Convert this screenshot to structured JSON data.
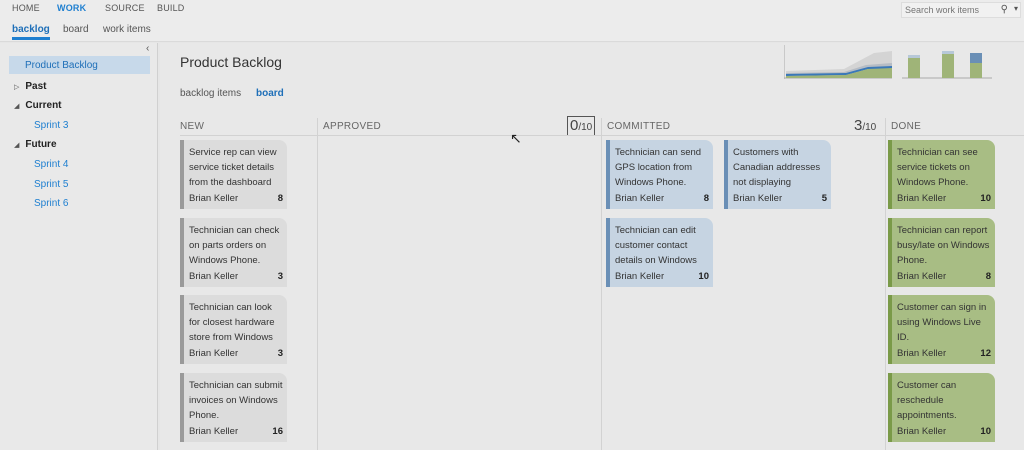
{
  "topnav": {
    "items": [
      "HOME",
      "WORK",
      "SOURCE",
      "BUILD"
    ],
    "active": "WORK",
    "search_placeholder": "Search work items"
  },
  "subnav": {
    "items": [
      "backlog",
      "board",
      "work items"
    ],
    "active": "backlog"
  },
  "sidebar": {
    "selected": "Product Backlog",
    "groups": [
      {
        "label": "Past",
        "expanded": false,
        "items": []
      },
      {
        "label": "Current",
        "expanded": true,
        "items": [
          "Sprint 3"
        ]
      },
      {
        "label": "Future",
        "expanded": true,
        "items": [
          "Sprint 4",
          "Sprint 5",
          "Sprint 6"
        ]
      }
    ]
  },
  "main": {
    "title": "Product Backlog",
    "tabs": [
      "backlog items",
      "board"
    ],
    "active_tab": "board"
  },
  "columns": [
    {
      "name": "NEW"
    },
    {
      "name": "APPROVED",
      "wip_current": "0",
      "wip_limit": "/10"
    },
    {
      "name": "COMMITTED",
      "wip_current": "3",
      "wip_limit": "/10"
    },
    {
      "name": "DONE"
    }
  ],
  "cards": {
    "new": [
      {
        "title": "Service rep can view service ticket details from the dashboard",
        "owner": "Brian Keller",
        "effort": "8"
      },
      {
        "title": "Technician can check on parts orders on Windows Phone.",
        "owner": "Brian Keller",
        "effort": "3"
      },
      {
        "title": "Technician can look for closest hardware store from Windows",
        "owner": "Brian Keller",
        "effort": "3"
      },
      {
        "title": "Technician can submit invoices on Windows Phone.",
        "owner": "Brian Keller",
        "effort": "16"
      }
    ],
    "committed": [
      {
        "title": "Technician can send GPS location from Windows Phone.",
        "owner": "Brian Keller",
        "effort": "8"
      },
      {
        "title": "Customers with Canadian addresses not displaying",
        "owner": "Brian Keller",
        "effort": "5"
      },
      {
        "title": "Technician can edit customer contact details on Windows",
        "owner": "Brian Keller",
        "effort": "10"
      }
    ],
    "done": [
      {
        "title": "Technician can see service tickets on Windows Phone.",
        "owner": "Brian Keller",
        "effort": "10"
      },
      {
        "title": "Technician can report busy/late on Windows Phone.",
        "owner": "Brian Keller",
        "effort": "8"
      },
      {
        "title": "Customer can sign in using Windows Live ID.",
        "owner": "Brian Keller",
        "effort": "12"
      },
      {
        "title": "Customer can reschedule appointments.",
        "owner": "Brian Keller",
        "effort": "10"
      }
    ]
  },
  "colors": {
    "accent": "#1e7fd0",
    "card_new": "#dcdcdc",
    "card_committed": "#c6d4e2",
    "card_done": "#a8bd84"
  }
}
